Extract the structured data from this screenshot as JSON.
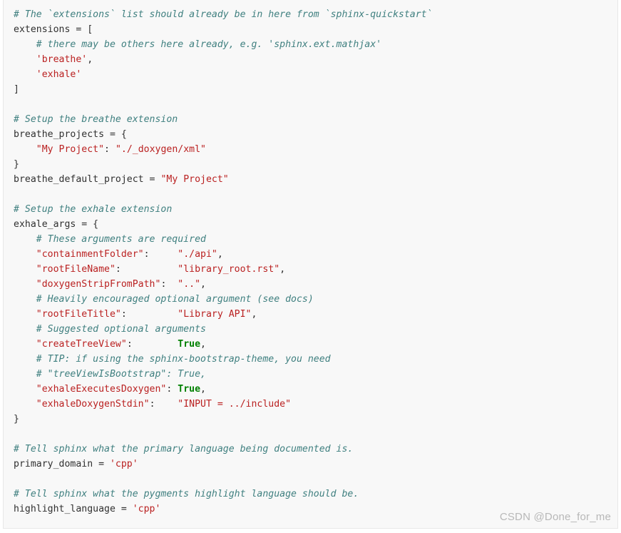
{
  "code_block": {
    "language": "python",
    "background_color": "#f8f8f8",
    "border_color": "#e8e8e8",
    "colors": {
      "text": "#303030",
      "comment": "#408080",
      "string": "#ba2121",
      "keyword": "#008000"
    },
    "lines": [
      {
        "id": "l1",
        "tokens": [
          {
            "t": "c",
            "v": "# The `extensions` list should already be in here from `sphinx-quickstart`"
          }
        ]
      },
      {
        "id": "l2",
        "tokens": [
          {
            "t": "n",
            "v": "extensions = ["
          }
        ]
      },
      {
        "id": "l3",
        "tokens": [
          {
            "t": "c",
            "v": "    # there may be others here already, e.g. 'sphinx.ext.mathjax'"
          }
        ]
      },
      {
        "id": "l4",
        "tokens": [
          {
            "t": "n",
            "v": "    "
          },
          {
            "t": "s",
            "v": "'breathe'"
          },
          {
            "t": "n",
            "v": ","
          }
        ]
      },
      {
        "id": "l5",
        "tokens": [
          {
            "t": "n",
            "v": "    "
          },
          {
            "t": "s",
            "v": "'exhale'"
          }
        ]
      },
      {
        "id": "l6",
        "tokens": [
          {
            "t": "n",
            "v": "]"
          }
        ]
      },
      {
        "id": "l7",
        "tokens": []
      },
      {
        "id": "l8",
        "tokens": [
          {
            "t": "c",
            "v": "# Setup the breathe extension"
          }
        ]
      },
      {
        "id": "l9",
        "tokens": [
          {
            "t": "n",
            "v": "breathe_projects = {"
          }
        ]
      },
      {
        "id": "l10",
        "tokens": [
          {
            "t": "n",
            "v": "    "
          },
          {
            "t": "s",
            "v": "\"My Project\""
          },
          {
            "t": "n",
            "v": ": "
          },
          {
            "t": "s",
            "v": "\"./_doxygen/xml\""
          }
        ]
      },
      {
        "id": "l11",
        "tokens": [
          {
            "t": "n",
            "v": "}"
          }
        ]
      },
      {
        "id": "l12",
        "tokens": [
          {
            "t": "n",
            "v": "breathe_default_project = "
          },
          {
            "t": "s",
            "v": "\"My Project\""
          }
        ]
      },
      {
        "id": "l13",
        "tokens": []
      },
      {
        "id": "l14",
        "tokens": [
          {
            "t": "c",
            "v": "# Setup the exhale extension"
          }
        ]
      },
      {
        "id": "l15",
        "tokens": [
          {
            "t": "n",
            "v": "exhale_args = {"
          }
        ]
      },
      {
        "id": "l16",
        "tokens": [
          {
            "t": "c",
            "v": "    # These arguments are required"
          }
        ]
      },
      {
        "id": "l17",
        "tokens": [
          {
            "t": "n",
            "v": "    "
          },
          {
            "t": "s",
            "v": "\"containmentFolder\""
          },
          {
            "t": "n",
            "v": ":     "
          },
          {
            "t": "s",
            "v": "\"./api\""
          },
          {
            "t": "n",
            "v": ","
          }
        ]
      },
      {
        "id": "l18",
        "tokens": [
          {
            "t": "n",
            "v": "    "
          },
          {
            "t": "s",
            "v": "\"rootFileName\""
          },
          {
            "t": "n",
            "v": ":          "
          },
          {
            "t": "s",
            "v": "\"library_root.rst\""
          },
          {
            "t": "n",
            "v": ","
          }
        ]
      },
      {
        "id": "l19",
        "tokens": [
          {
            "t": "n",
            "v": "    "
          },
          {
            "t": "s",
            "v": "\"doxygenStripFromPath\""
          },
          {
            "t": "n",
            "v": ":  "
          },
          {
            "t": "s",
            "v": "\"..\""
          },
          {
            "t": "n",
            "v": ","
          }
        ]
      },
      {
        "id": "l20",
        "tokens": [
          {
            "t": "c",
            "v": "    # Heavily encouraged optional argument (see docs)"
          }
        ]
      },
      {
        "id": "l21",
        "tokens": [
          {
            "t": "n",
            "v": "    "
          },
          {
            "t": "s",
            "v": "\"rootFileTitle\""
          },
          {
            "t": "n",
            "v": ":         "
          },
          {
            "t": "s",
            "v": "\"Library API\""
          },
          {
            "t": "n",
            "v": ","
          }
        ]
      },
      {
        "id": "l22",
        "tokens": [
          {
            "t": "c",
            "v": "    # Suggested optional arguments"
          }
        ]
      },
      {
        "id": "l23",
        "tokens": [
          {
            "t": "n",
            "v": "    "
          },
          {
            "t": "s",
            "v": "\"createTreeView\""
          },
          {
            "t": "n",
            "v": ":        "
          },
          {
            "t": "k",
            "v": "True"
          },
          {
            "t": "n",
            "v": ","
          }
        ]
      },
      {
        "id": "l24",
        "tokens": [
          {
            "t": "c",
            "v": "    # TIP: if using the sphinx-bootstrap-theme, you need"
          }
        ]
      },
      {
        "id": "l25",
        "tokens": [
          {
            "t": "c",
            "v": "    # \"treeViewIsBootstrap\": True,"
          }
        ]
      },
      {
        "id": "l26",
        "tokens": [
          {
            "t": "n",
            "v": "    "
          },
          {
            "t": "s",
            "v": "\"exhaleExecutesDoxygen\""
          },
          {
            "t": "n",
            "v": ": "
          },
          {
            "t": "k",
            "v": "True"
          },
          {
            "t": "n",
            "v": ","
          }
        ]
      },
      {
        "id": "l27",
        "tokens": [
          {
            "t": "n",
            "v": "    "
          },
          {
            "t": "s",
            "v": "\"exhaleDoxygenStdin\""
          },
          {
            "t": "n",
            "v": ":    "
          },
          {
            "t": "s",
            "v": "\"INPUT = ../include\""
          }
        ]
      },
      {
        "id": "l28",
        "tokens": [
          {
            "t": "n",
            "v": "}"
          }
        ]
      },
      {
        "id": "l29",
        "tokens": []
      },
      {
        "id": "l30",
        "tokens": [
          {
            "t": "c",
            "v": "# Tell sphinx what the primary language being documented is."
          }
        ]
      },
      {
        "id": "l31",
        "tokens": [
          {
            "t": "n",
            "v": "primary_domain = "
          },
          {
            "t": "s",
            "v": "'cpp'"
          }
        ]
      },
      {
        "id": "l32",
        "tokens": []
      },
      {
        "id": "l33",
        "tokens": [
          {
            "t": "c",
            "v": "# Tell sphinx what the pygments highlight language should be."
          }
        ]
      },
      {
        "id": "l34",
        "tokens": [
          {
            "t": "n",
            "v": "highlight_language = "
          },
          {
            "t": "s",
            "v": "'cpp'"
          }
        ]
      }
    ]
  },
  "watermark": {
    "text": "CSDN @Done_for_me",
    "color": "#b8b8b8"
  }
}
